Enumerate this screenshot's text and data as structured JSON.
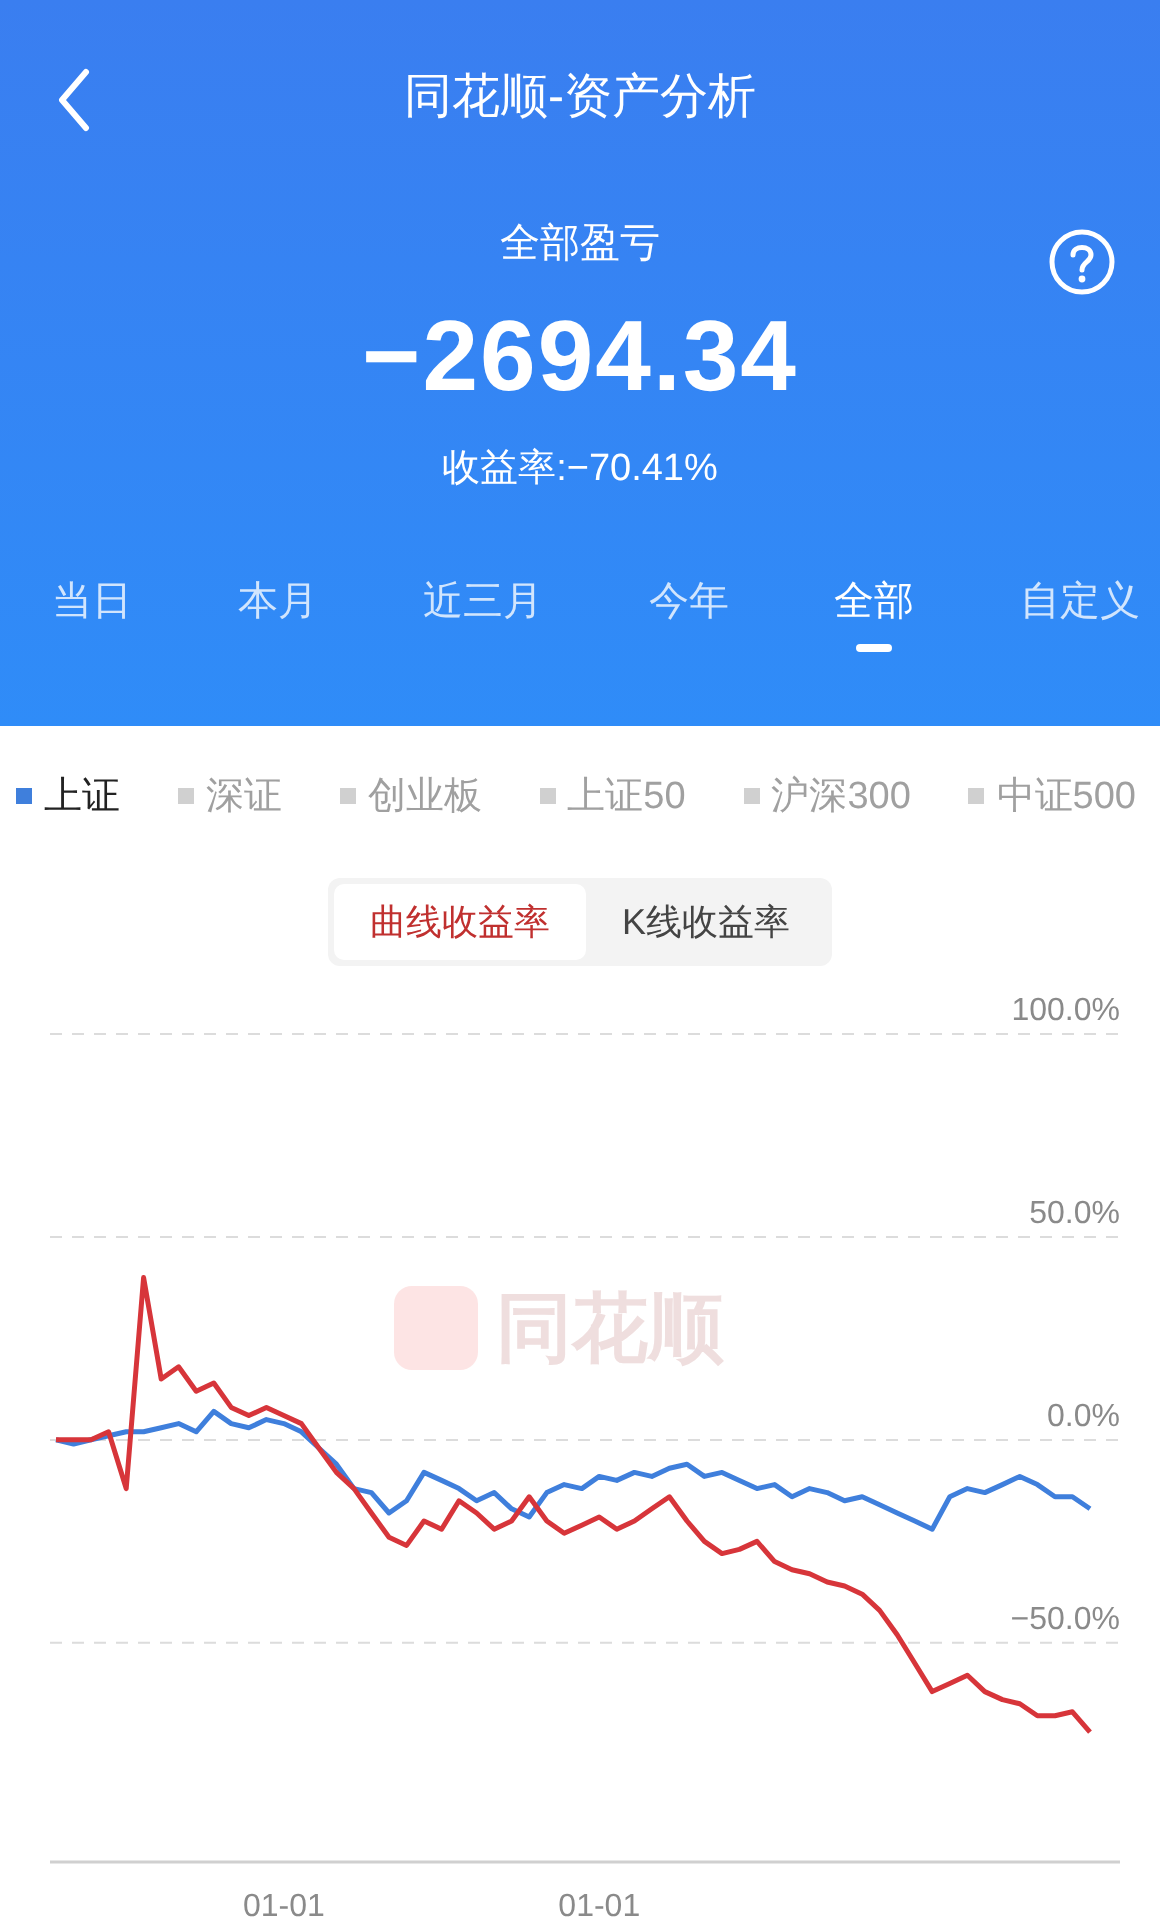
{
  "header": {
    "title": "同花顺-资产分析",
    "summary_label": "全部盈亏",
    "total": "−2694.34",
    "return_rate": "收益率:−70.41%"
  },
  "tabs": [
    {
      "label": "当日",
      "selected": false
    },
    {
      "label": "本月",
      "selected": false
    },
    {
      "label": "近三月",
      "selected": false
    },
    {
      "label": "今年",
      "selected": false
    },
    {
      "label": "全部",
      "selected": true
    },
    {
      "label": "自定义",
      "selected": false
    }
  ],
  "indices": [
    {
      "label": "上证",
      "selected": true
    },
    {
      "label": "深证",
      "selected": false
    },
    {
      "label": "创业板",
      "selected": false
    },
    {
      "label": "上证50",
      "selected": false
    },
    {
      "label": "沪深300",
      "selected": false
    },
    {
      "label": "中证500",
      "selected": false
    }
  ],
  "chart_modes": [
    {
      "label": "曲线收益率",
      "selected": true
    },
    {
      "label": "K线收益率",
      "selected": false
    }
  ],
  "chart_watermark": "同花顺",
  "chart_data": {
    "type": "line",
    "series": [
      {
        "color": "#d7353a",
        "values": [
          0,
          0,
          0,
          2,
          -12,
          40,
          15,
          18,
          12,
          14,
          8,
          6,
          8,
          6,
          4,
          -2,
          -8,
          -12,
          -18,
          -24,
          -26,
          -20,
          -22,
          -15,
          -18,
          -22,
          -20,
          -14,
          -20,
          -23,
          -21,
          -19,
          -22,
          -20,
          -17,
          -14,
          -20,
          -25,
          -28,
          -27,
          -25,
          -30,
          -32,
          -33,
          -35,
          -36,
          -38,
          -42,
          -48,
          -55,
          -62,
          -60,
          -58,
          -62,
          -64,
          -65,
          -68,
          -68,
          -67,
          -72
        ]
      },
      {
        "color": "#3f7fdc",
        "values": [
          0,
          -1,
          0,
          1,
          2,
          2,
          3,
          4,
          2,
          7,
          4,
          3,
          5,
          4,
          2,
          -2,
          -6,
          -12,
          -13,
          -18,
          -15,
          -8,
          -10,
          -12,
          -15,
          -13,
          -17,
          -19,
          -13,
          -11,
          -12,
          -9,
          -10,
          -8,
          -9,
          -7,
          -6,
          -9,
          -8,
          -10,
          -12,
          -11,
          -14,
          -12,
          -13,
          -15,
          -14,
          -16,
          -18,
          -20,
          -22,
          -14,
          -12,
          -13,
          -11,
          -9,
          -11,
          -14,
          -14,
          -17
        ]
      }
    ],
    "categories": [
      null,
      null,
      null,
      null,
      null,
      null,
      null,
      null,
      null,
      null,
      null,
      null,
      null,
      "01-01",
      null,
      null,
      null,
      null,
      null,
      null,
      null,
      null,
      null,
      null,
      null,
      null,
      null,
      null,
      null,
      null,
      null,
      "01-01",
      null,
      null,
      null,
      null,
      null,
      null,
      null,
      null,
      null,
      null,
      null,
      null,
      null,
      null,
      null,
      null,
      null,
      null,
      null,
      null,
      null,
      null,
      null,
      null,
      null,
      null,
      null,
      null
    ],
    "ylim": [
      -104,
      100
    ],
    "grid": true,
    "yticks": [
      {
        "value": 100,
        "label": "100.0%"
      },
      {
        "value": 50,
        "label": "50.0%"
      },
      {
        "value": 0,
        "label": "0.0%"
      },
      {
        "value": -50,
        "label": "−50.0%"
      }
    ]
  }
}
